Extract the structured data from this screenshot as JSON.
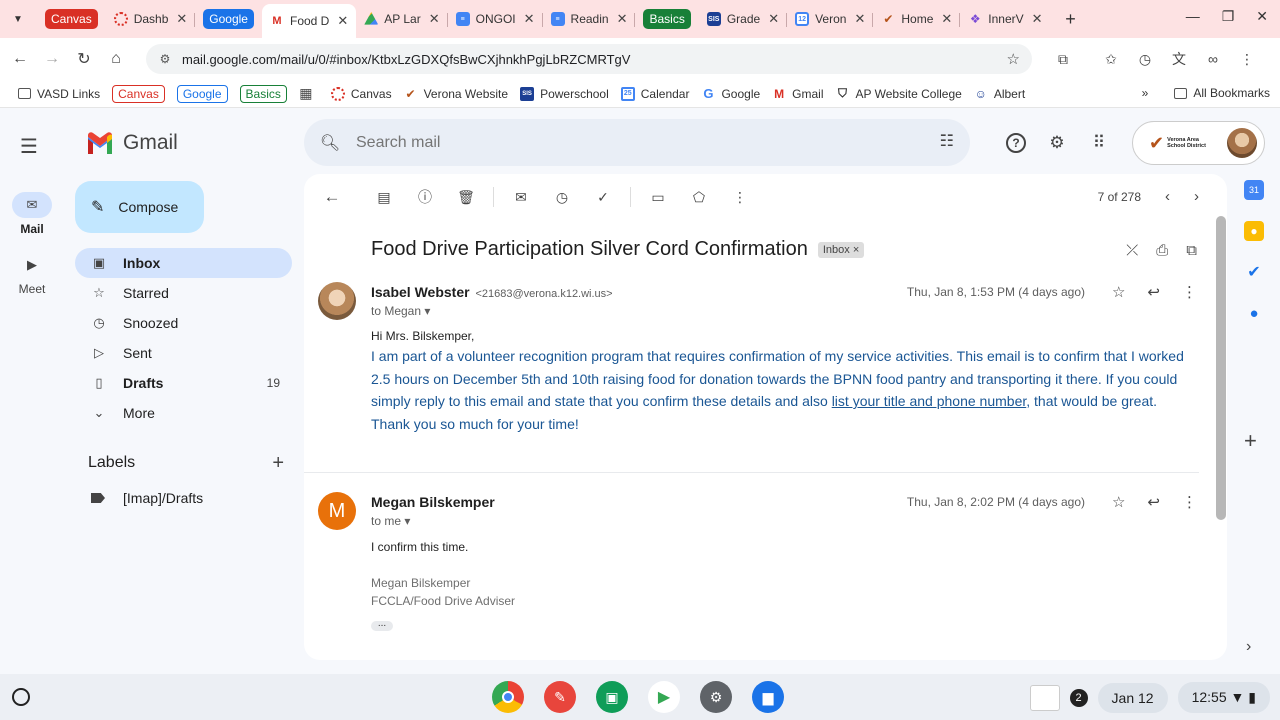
{
  "browser": {
    "tabs": [
      {
        "label": "Canvas",
        "kind": "chip",
        "color": "#d93025"
      },
      {
        "label": "Dashb",
        "kind": "tab",
        "icon": "canvas-icon"
      },
      {
        "label": "Google",
        "kind": "chip",
        "color": "#1a73e8"
      },
      {
        "label": "Food D",
        "kind": "tab",
        "icon": "gmail-icon",
        "active": true
      },
      {
        "label": "AP Lar",
        "kind": "tab",
        "icon": "drive-icon"
      },
      {
        "label": "ONGOI",
        "kind": "tab",
        "icon": "docs-icon"
      },
      {
        "label": "Readin",
        "kind": "tab",
        "icon": "docs-icon"
      },
      {
        "label": "Basics",
        "kind": "chip",
        "color": "#188038"
      },
      {
        "label": "Grade",
        "kind": "tab",
        "icon": "sis-icon"
      },
      {
        "label": "Veron",
        "kind": "tab",
        "icon": "calendar-icon"
      },
      {
        "label": "Home",
        "kind": "tab",
        "icon": "verona-icon"
      },
      {
        "label": "InnerV",
        "kind": "tab",
        "icon": "innerview-icon"
      }
    ],
    "url": "mail.google.com/mail/u/0/#inbox/KtbxLzGDXQfsBwCXjhnkhPgjLbRZCMRTgV",
    "bookmarks": [
      {
        "label": "VASD Links",
        "icon": "folder-icon"
      },
      {
        "label": "Canvas",
        "chip": "#d93025"
      },
      {
        "label": "Google",
        "chip": "#1a73e8"
      },
      {
        "label": "Basics",
        "chip": "#188038"
      },
      {
        "label": "",
        "icon": "apps-grid-icon"
      },
      {
        "label": "Canvas",
        "icon": "canvas-icon"
      },
      {
        "label": "Verona Website",
        "icon": "verona-icon"
      },
      {
        "label": "Powerschool",
        "icon": "sis-icon"
      },
      {
        "label": "Calendar",
        "icon": "calendar-icon"
      },
      {
        "label": "Google",
        "icon": "google-icon"
      },
      {
        "label": "Gmail",
        "icon": "gmail-icon"
      },
      {
        "label": "AP Website College",
        "icon": "shield-icon"
      },
      {
        "label": "Albert",
        "icon": "albert-icon"
      }
    ],
    "all_bookmarks": "All Bookmarks"
  },
  "gmail": {
    "logo_text": "Gmail",
    "search_placeholder": "Search mail",
    "compose": "Compose",
    "rail": {
      "mail": "Mail",
      "meet": "Meet"
    },
    "nav": [
      {
        "label": "Inbox",
        "icon": "inbox-icon",
        "active": true,
        "count": ""
      },
      {
        "label": "Starred",
        "icon": "star-icon",
        "count": ""
      },
      {
        "label": "Snoozed",
        "icon": "clock-icon",
        "count": ""
      },
      {
        "label": "Sent",
        "icon": "send-icon",
        "count": ""
      },
      {
        "label": "Drafts",
        "icon": "draft-icon",
        "bold": true,
        "count": "19"
      },
      {
        "label": "More",
        "icon": "chevron-down-icon",
        "count": ""
      }
    ],
    "labels_title": "Labels",
    "labels": [
      {
        "label": "[Imap]/Drafts"
      }
    ],
    "org": "Verona Area School District"
  },
  "thread": {
    "pager": "7 of 278",
    "subject": "Food Drive Participation Silver Cord Confirmation",
    "chip": "Inbox",
    "messages": [
      {
        "sender": "Isabel Webster",
        "email": "<21683@verona.k12.wi.us>",
        "to": "to Megan",
        "date": "Thu, Jan 8, 1:53 PM (4 days ago)",
        "greeting": "Hi Mrs. Bilskemper,",
        "body_1": "I am part of a volunteer recognition program that requires confirmation of my service activities. This email is to confirm that I worked 2.5 hours on December 5th and 10th raising food for donation towards the BPNN food pantry and transporting it there. If you could simply reply to this email and state that you confirm these details and also ",
        "body_link": "list your title and phone number",
        "body_2": ", that would be great. Thank you so much for your time!"
      },
      {
        "sender": "Megan Bilskemper",
        "initial": "M",
        "to": "to me",
        "date": "Thu, Jan 8, 2:02 PM (4 days ago)",
        "body": "I confirm this time.",
        "sig_name": "Megan Bilskemper",
        "sig_title": "FCCLA/Food Drive Adviser"
      }
    ]
  },
  "shelf": {
    "notifications": "2",
    "date": "Jan 12",
    "time": "12:55"
  }
}
